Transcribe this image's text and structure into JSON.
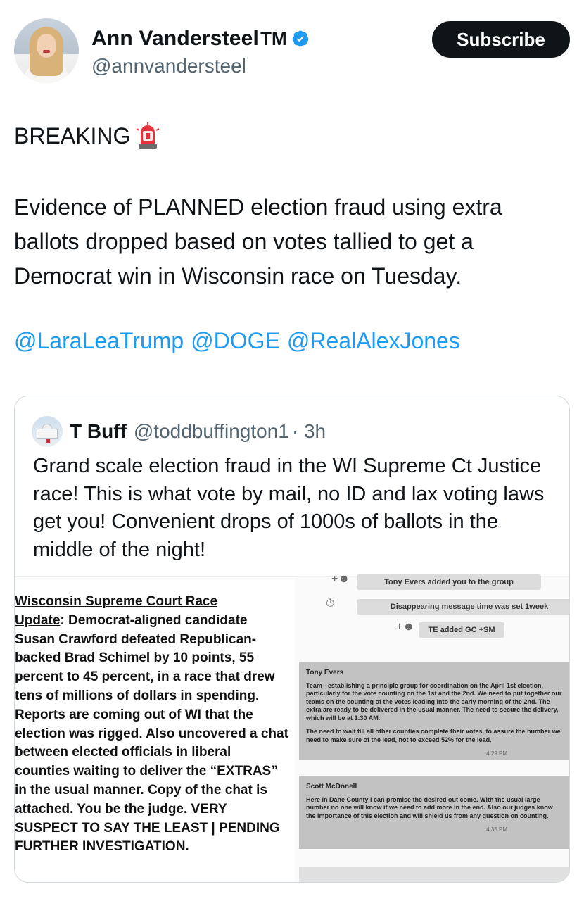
{
  "author": {
    "name": "Ann Vandersteel",
    "tm": "TM",
    "handle": "@annvandersteel",
    "verified_icon": "verified-badge-icon",
    "subscribe_label": "Subscribe"
  },
  "tweet": {
    "breaking": "BREAKING",
    "siren_icon": "police-light-emoji",
    "body": "Evidence of PLANNED election fraud using extra ballots dropped  based on votes tallied to get a Democrat win in Wisconsin race on Tuesday.",
    "mentions": [
      "@LaraLeaTrump",
      "@DOGE",
      "@RealAlexJones"
    ]
  },
  "quoted": {
    "name": "T Buff",
    "handle": "@toddbuffington1",
    "time": "· 3h",
    "text": "Grand scale election fraud in the WI Supreme Ct Justice race!  This is what vote by mail, no ID and lax voting laws get you!  Convenient drops of 1000s of ballots in the middle of the night!",
    "image": {
      "doc_title_1": "Wisconsin Supreme Court Race",
      "doc_title_2": "Update",
      "doc_body": ": Democrat-aligned candidate Susan Crawford defeated Republican-backed Brad Schimel by 10 points, 55 percent to 45 percent, in a race that drew tens of millions of dollars in spending.  Reports are coming out of WI that the election was rigged.  Also uncovered a chat between elected officials in liberal counties waiting to deliver the “EXTRAS” in the usual manner.  Copy of the chat is attached.  You be the judge.  VERY SUSPECT TO SAY THE LEAST | PENDING FURTHER INVESTIGATION.",
      "chat": {
        "sys1": "Tony Evers added you to the group",
        "sys2": "Disappearing message time was set 1week",
        "sys3": "TE added GC +SM",
        "msg1_sender": "Tony Evers",
        "msg1_p1": "Team - establishing a principle group for coordination on the April 1st election, particularly for the vote counting on the 1st and the 2nd. We need to put together our teams on the counting of the votes leading into the early morning of the 2nd. The extra are ready to be delivered in the usual manner. The need to secure the delivery, which will be at 1:30 AM.",
        "msg1_p2": "The need to wait till all other counties complete their votes, to assure the number we need to make sure of the lead, not to exceed 52% for the lead.",
        "msg1_time": "4:29 PM",
        "msg2_sender": "Scott McDonell",
        "msg2_p1": "Here in Dane County I can promise the desired out come. With the usual large number no one will know if we need to add more in the end. Also our judges know the importance of this election and will shield us from any question on counting.",
        "msg2_time": "4:35 PM"
      }
    }
  }
}
